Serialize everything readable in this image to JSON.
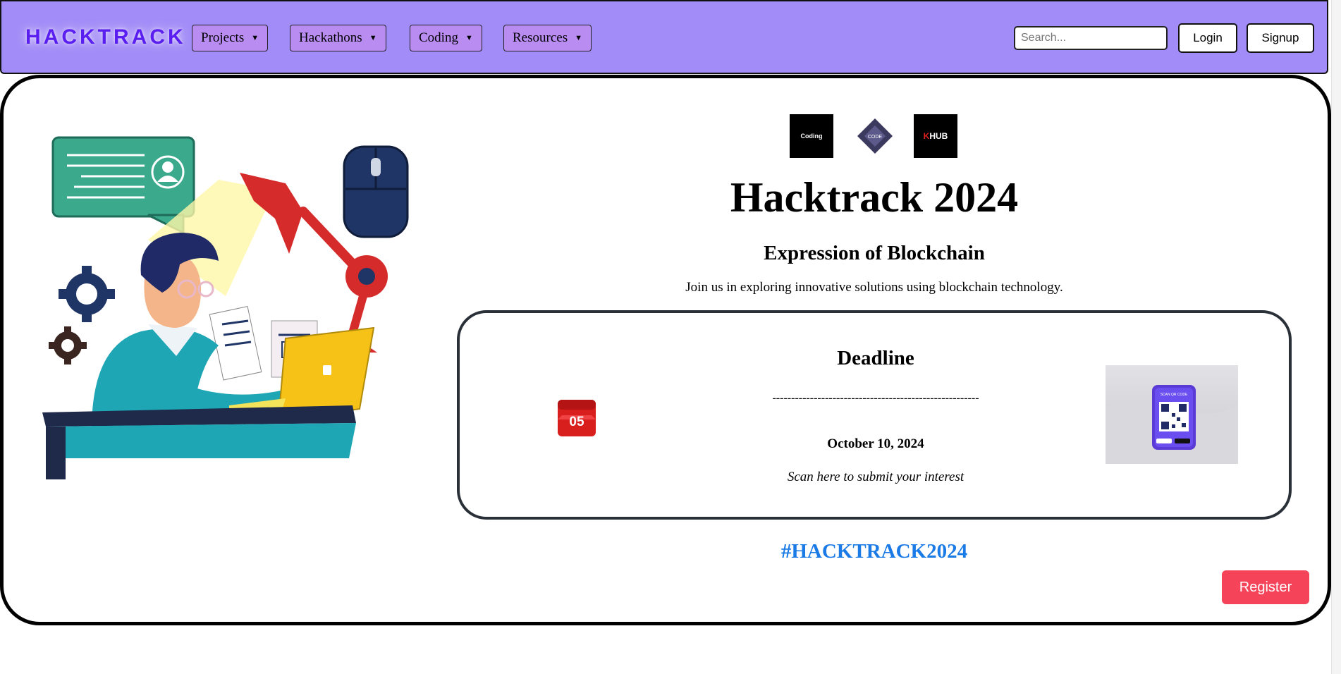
{
  "nav": {
    "logo": "HACKTRACK",
    "menus": [
      {
        "label": "Projects",
        "caret": "▼"
      },
      {
        "label": "Hackathons",
        "caret": "▼"
      },
      {
        "label": "Coding",
        "caret": "▼"
      },
      {
        "label": "Resources",
        "caret": "▼"
      }
    ],
    "search_placeholder": "Search...",
    "login_label": "Login",
    "signup_label": "Signup"
  },
  "event": {
    "sponsors": {
      "coding_text": "Coding",
      "code_text": "CODE",
      "khub_k": "K",
      "khub_rest": "HUB"
    },
    "title": "Hacktrack 2024",
    "subtitle": "Expression of Blockchain",
    "tagline": "Join us in exploring innovative solutions using blockchain technology.",
    "deadline": {
      "calendar_day": "05",
      "heading": "Deadline",
      "divider": "-------------------------------------------------------",
      "date": "October 10, 2024",
      "note": "Scan here to submit your interest",
      "qr_caption": "SCAN QR CODE"
    },
    "hashtag": "#HACKTRACK2024",
    "register_label": "Register"
  },
  "colors": {
    "navbar_bg": "#a28cf7",
    "menu_bg": "#b98cf2",
    "logo": "#5a1ff0",
    "hashtag": "#1a7ae6",
    "register": "#f5435a"
  }
}
